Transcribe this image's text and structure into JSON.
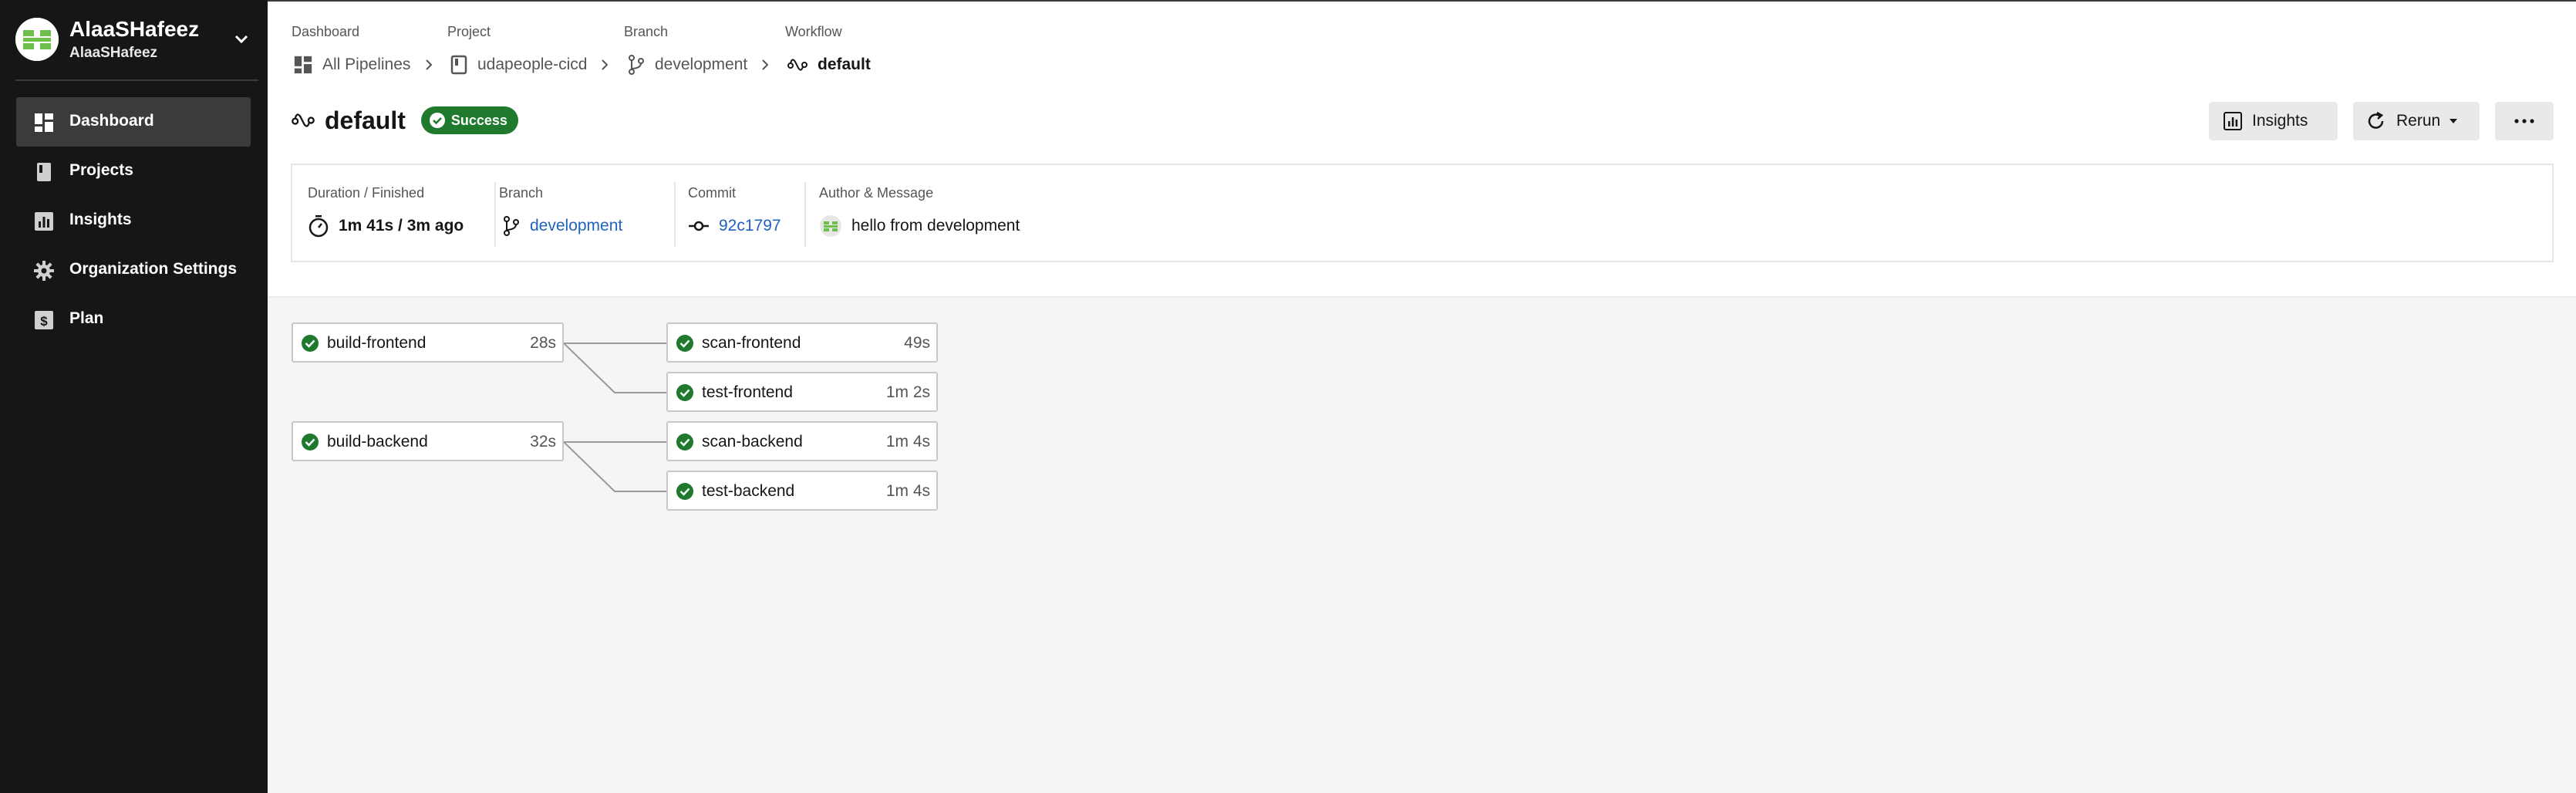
{
  "org": {
    "name": "AlaaSHafeez",
    "username": "AlaaSHafeez"
  },
  "sidebar": {
    "items": [
      {
        "label": "Dashboard",
        "icon": "dashboard-icon",
        "active": true
      },
      {
        "label": "Projects",
        "icon": "book-icon"
      },
      {
        "label": "Insights",
        "icon": "insights-icon"
      },
      {
        "label": "Organization Settings",
        "icon": "gear-icon"
      },
      {
        "label": "Plan",
        "icon": "dollar-icon"
      }
    ]
  },
  "breadcrumb": [
    {
      "label": "Dashboard",
      "value": "All Pipelines",
      "icon": "dashboard-icon"
    },
    {
      "label": "Project",
      "value": "udapeople-cicd",
      "icon": "book-icon"
    },
    {
      "label": "Branch",
      "value": "development",
      "icon": "branch-icon"
    },
    {
      "label": "Workflow",
      "value": "default",
      "icon": "workflow-icon"
    }
  ],
  "workflow": {
    "title": "default",
    "status": "Success"
  },
  "actions": {
    "insights": "Insights",
    "rerun": "Rerun",
    "more": "more-icon"
  },
  "info": {
    "duration_label": "Duration / Finished",
    "duration_value": "1m 41s / 3m ago",
    "branch_label": "Branch",
    "branch_value": "development",
    "commit_label": "Commit",
    "commit_value": "92c1797",
    "author_label": "Author & Message",
    "message": "hello from development"
  },
  "jobs": [
    {
      "name": "build-frontend",
      "duration": "28s",
      "status": "success"
    },
    {
      "name": "scan-frontend",
      "duration": "49s",
      "status": "success"
    },
    {
      "name": "test-frontend",
      "duration": "1m 2s",
      "status": "success"
    },
    {
      "name": "build-backend",
      "duration": "32s",
      "status": "success"
    },
    {
      "name": "scan-backend",
      "duration": "1m 4s",
      "status": "success"
    },
    {
      "name": "test-backend",
      "duration": "1m 4s",
      "status": "success"
    }
  ],
  "colors": {
    "sidebar_bg": "#161616",
    "success": "#1f7a2e",
    "link": "#1f63bd",
    "graph_bg": "#f5f5f5"
  }
}
